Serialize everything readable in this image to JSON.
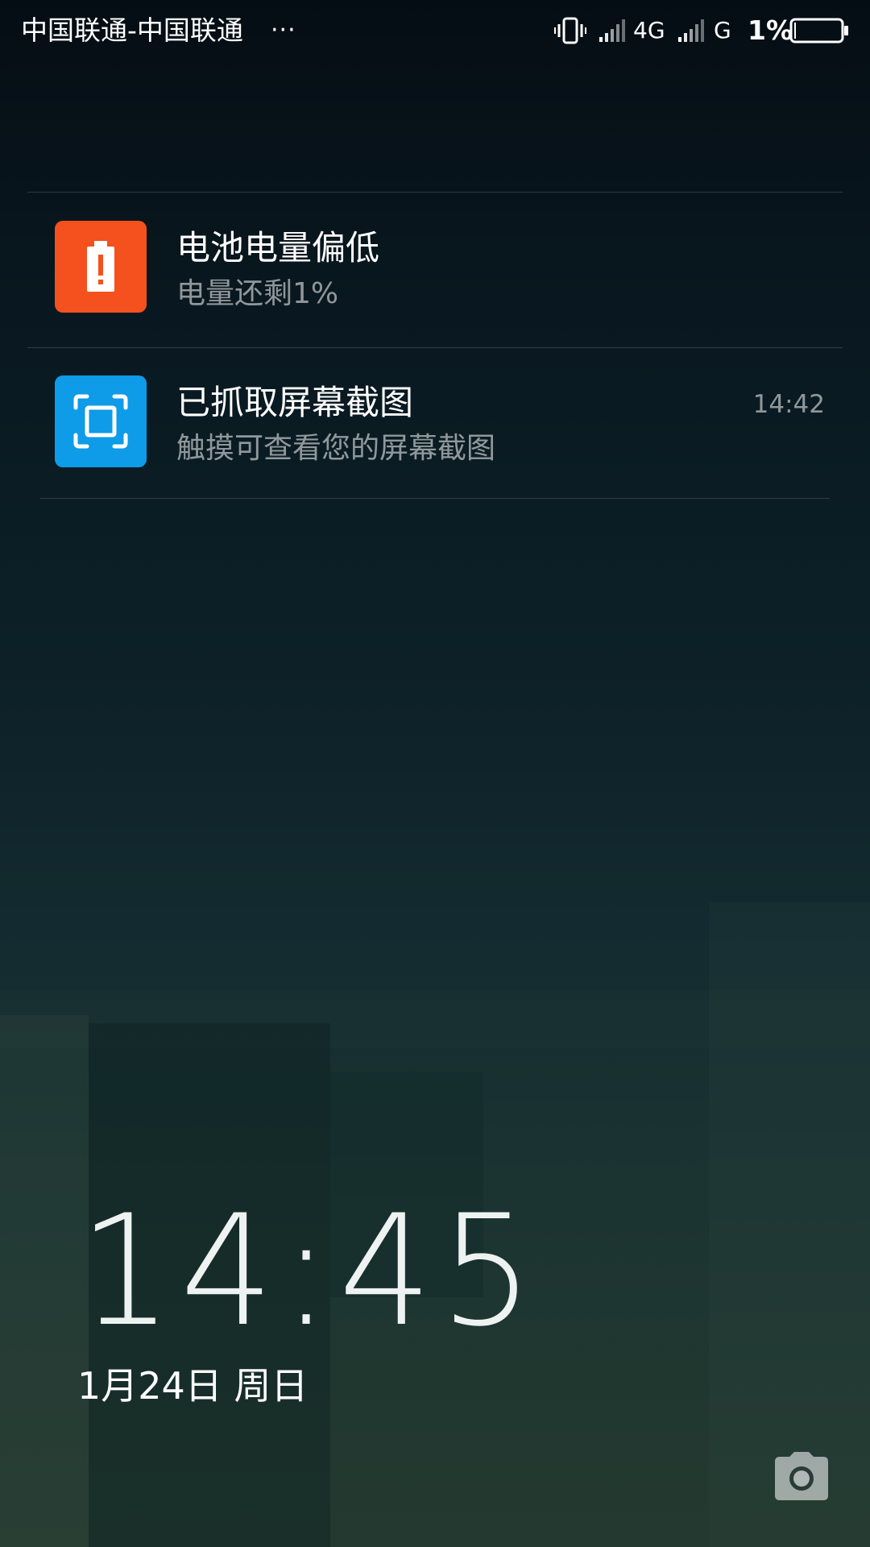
{
  "status_bar": {
    "carrier": "中国联通-中国联通",
    "more_indicator": "···",
    "network_1": "4G",
    "network_2": "G",
    "battery_percent": "1%",
    "icons": [
      "vibrate-icon",
      "signal-icon",
      "signal-icon",
      "battery-icon"
    ]
  },
  "notifications": [
    {
      "title": "电池电量偏低",
      "text": "电量还剩1%",
      "time": "",
      "icon": "battery-alert-icon",
      "icon_color": "#f4511e"
    },
    {
      "title": "已抓取屏幕截图",
      "text": "触摸可查看您的屏幕截图",
      "time": "14:42",
      "icon": "screenshot-icon",
      "icon_color": "#0e9be8"
    }
  ],
  "lockscreen": {
    "time": "14:45",
    "date": "1月24日 周日",
    "camera_icon": "camera-icon"
  }
}
